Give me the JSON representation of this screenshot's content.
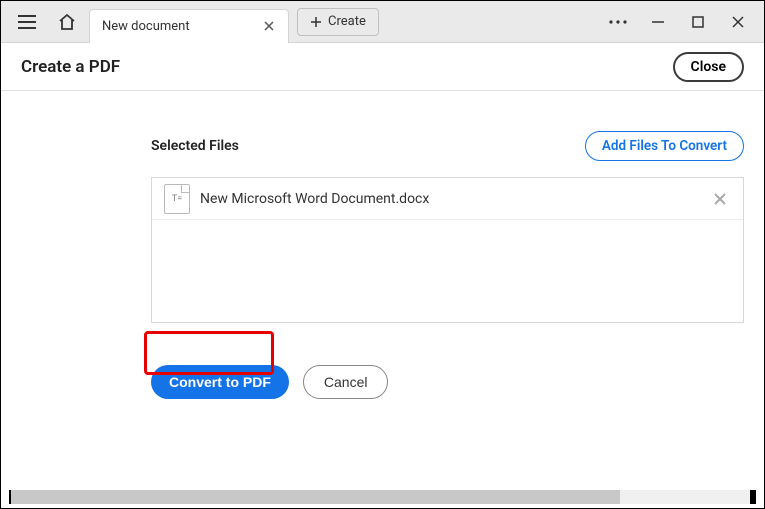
{
  "titlebar": {
    "tab_title": "New document",
    "create_label": "Create"
  },
  "header": {
    "title": "Create a PDF",
    "close_label": "Close"
  },
  "main": {
    "selected_label": "Selected Files",
    "add_files_label": "Add Files To Convert",
    "files": [
      {
        "name": "New Microsoft Word Document.docx",
        "icon_text": "T="
      }
    ],
    "convert_label": "Convert to PDF",
    "cancel_label": "Cancel"
  }
}
